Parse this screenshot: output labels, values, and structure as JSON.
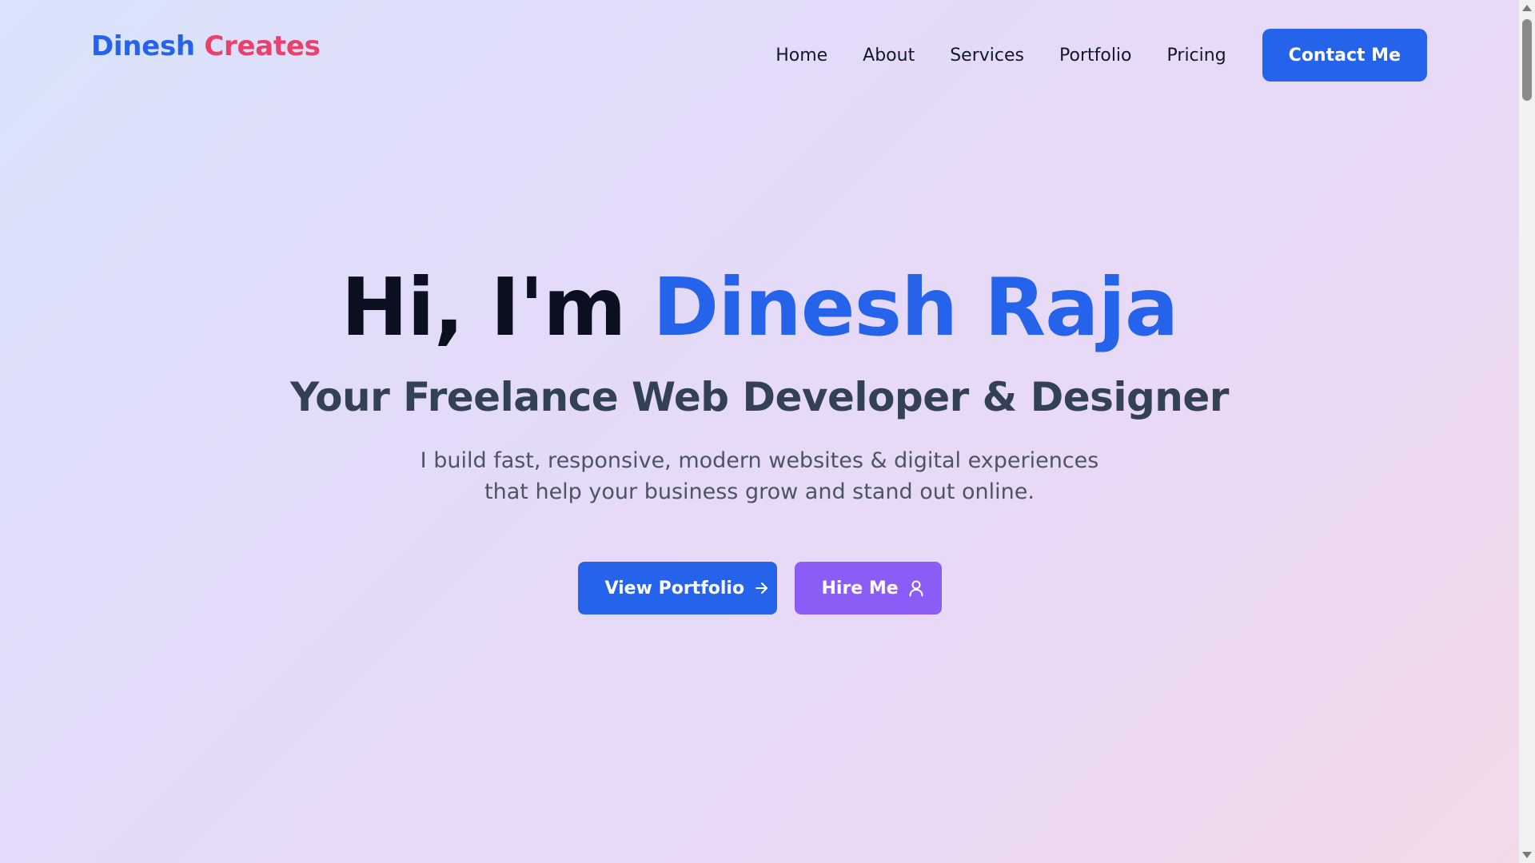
{
  "header": {
    "logo_first": "Dinesh",
    "logo_second": "Creates",
    "nav": [
      "Home",
      "About",
      "Services",
      "Portfolio",
      "Pricing"
    ],
    "contact_label": "Contact Me"
  },
  "hero": {
    "greeting": "Hi, I'm",
    "name": "Dinesh Raja",
    "subtitle": "Your Freelance Web Developer & Designer",
    "description": "I build fast, responsive, modern websites & digital experiences that help your business grow and stand out online.",
    "primary_cta": "View Portfolio",
    "primary_cta_icon": "arrow-right-icon",
    "secondary_cta": "Hire Me",
    "secondary_cta_icon": "user-icon"
  },
  "colors": {
    "brand_blue": "#2563eb",
    "brand_pink": "#e8416b",
    "accent_purple": "#8b5cf6"
  }
}
